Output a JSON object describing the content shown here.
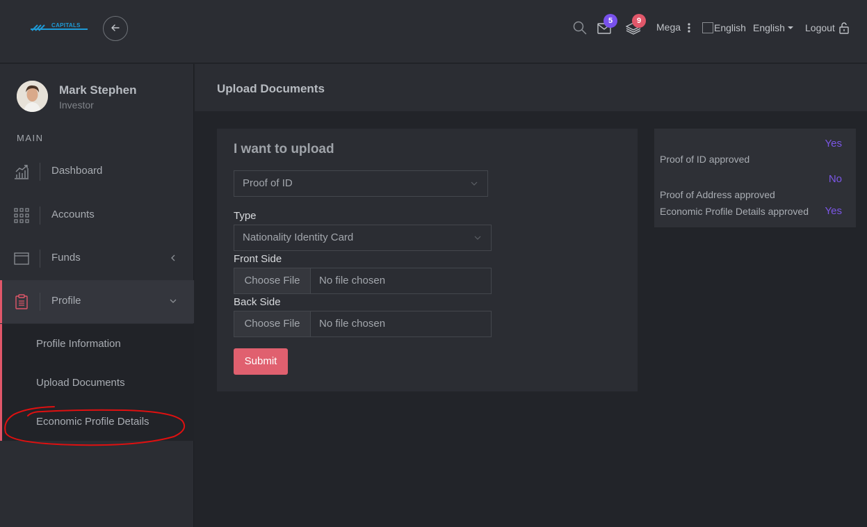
{
  "header": {
    "logo_text": "CAPITALS",
    "messages_count": "5",
    "notifications_count": "9",
    "user_name": "Mega",
    "flag_alt": "English",
    "language": "English",
    "logout_label": "Logout",
    "colors": {
      "badge_messages": "#7851ec",
      "badge_notifications": "#e1576a"
    }
  },
  "sidebar": {
    "profile": {
      "name": "Mark Stephen",
      "role": "Investor"
    },
    "section_label": "MAIN",
    "items": [
      {
        "label": "Dashboard",
        "icon": "chart-icon"
      },
      {
        "label": "Accounts",
        "icon": "grid-icon"
      },
      {
        "label": "Funds",
        "icon": "window-icon"
      },
      {
        "label": "Profile",
        "icon": "clipboard-icon"
      }
    ],
    "profile_submenu": [
      {
        "label": "Profile Information"
      },
      {
        "label": "Upload Documents"
      },
      {
        "label": "Economic Profile Details"
      }
    ],
    "accent_color": "#e1576a"
  },
  "page": {
    "title": "Upload Documents"
  },
  "upload_form": {
    "heading": "I want to upload",
    "document_select": "Proof of ID",
    "type_label": "Type",
    "type_select": "Nationality Identity Card",
    "front_label": "Front Side",
    "back_label": "Back Side",
    "choose_file_label": "Choose File",
    "no_file_label": "No file chosen",
    "submit_label": "Submit",
    "submit_color": "#e0606f"
  },
  "status": [
    {
      "label": "Proof of ID approved",
      "value": "Yes"
    },
    {
      "label": "Proof of Address approved",
      "value": "No"
    },
    {
      "label": "Economic Profile Details approved",
      "value": "Yes"
    }
  ]
}
